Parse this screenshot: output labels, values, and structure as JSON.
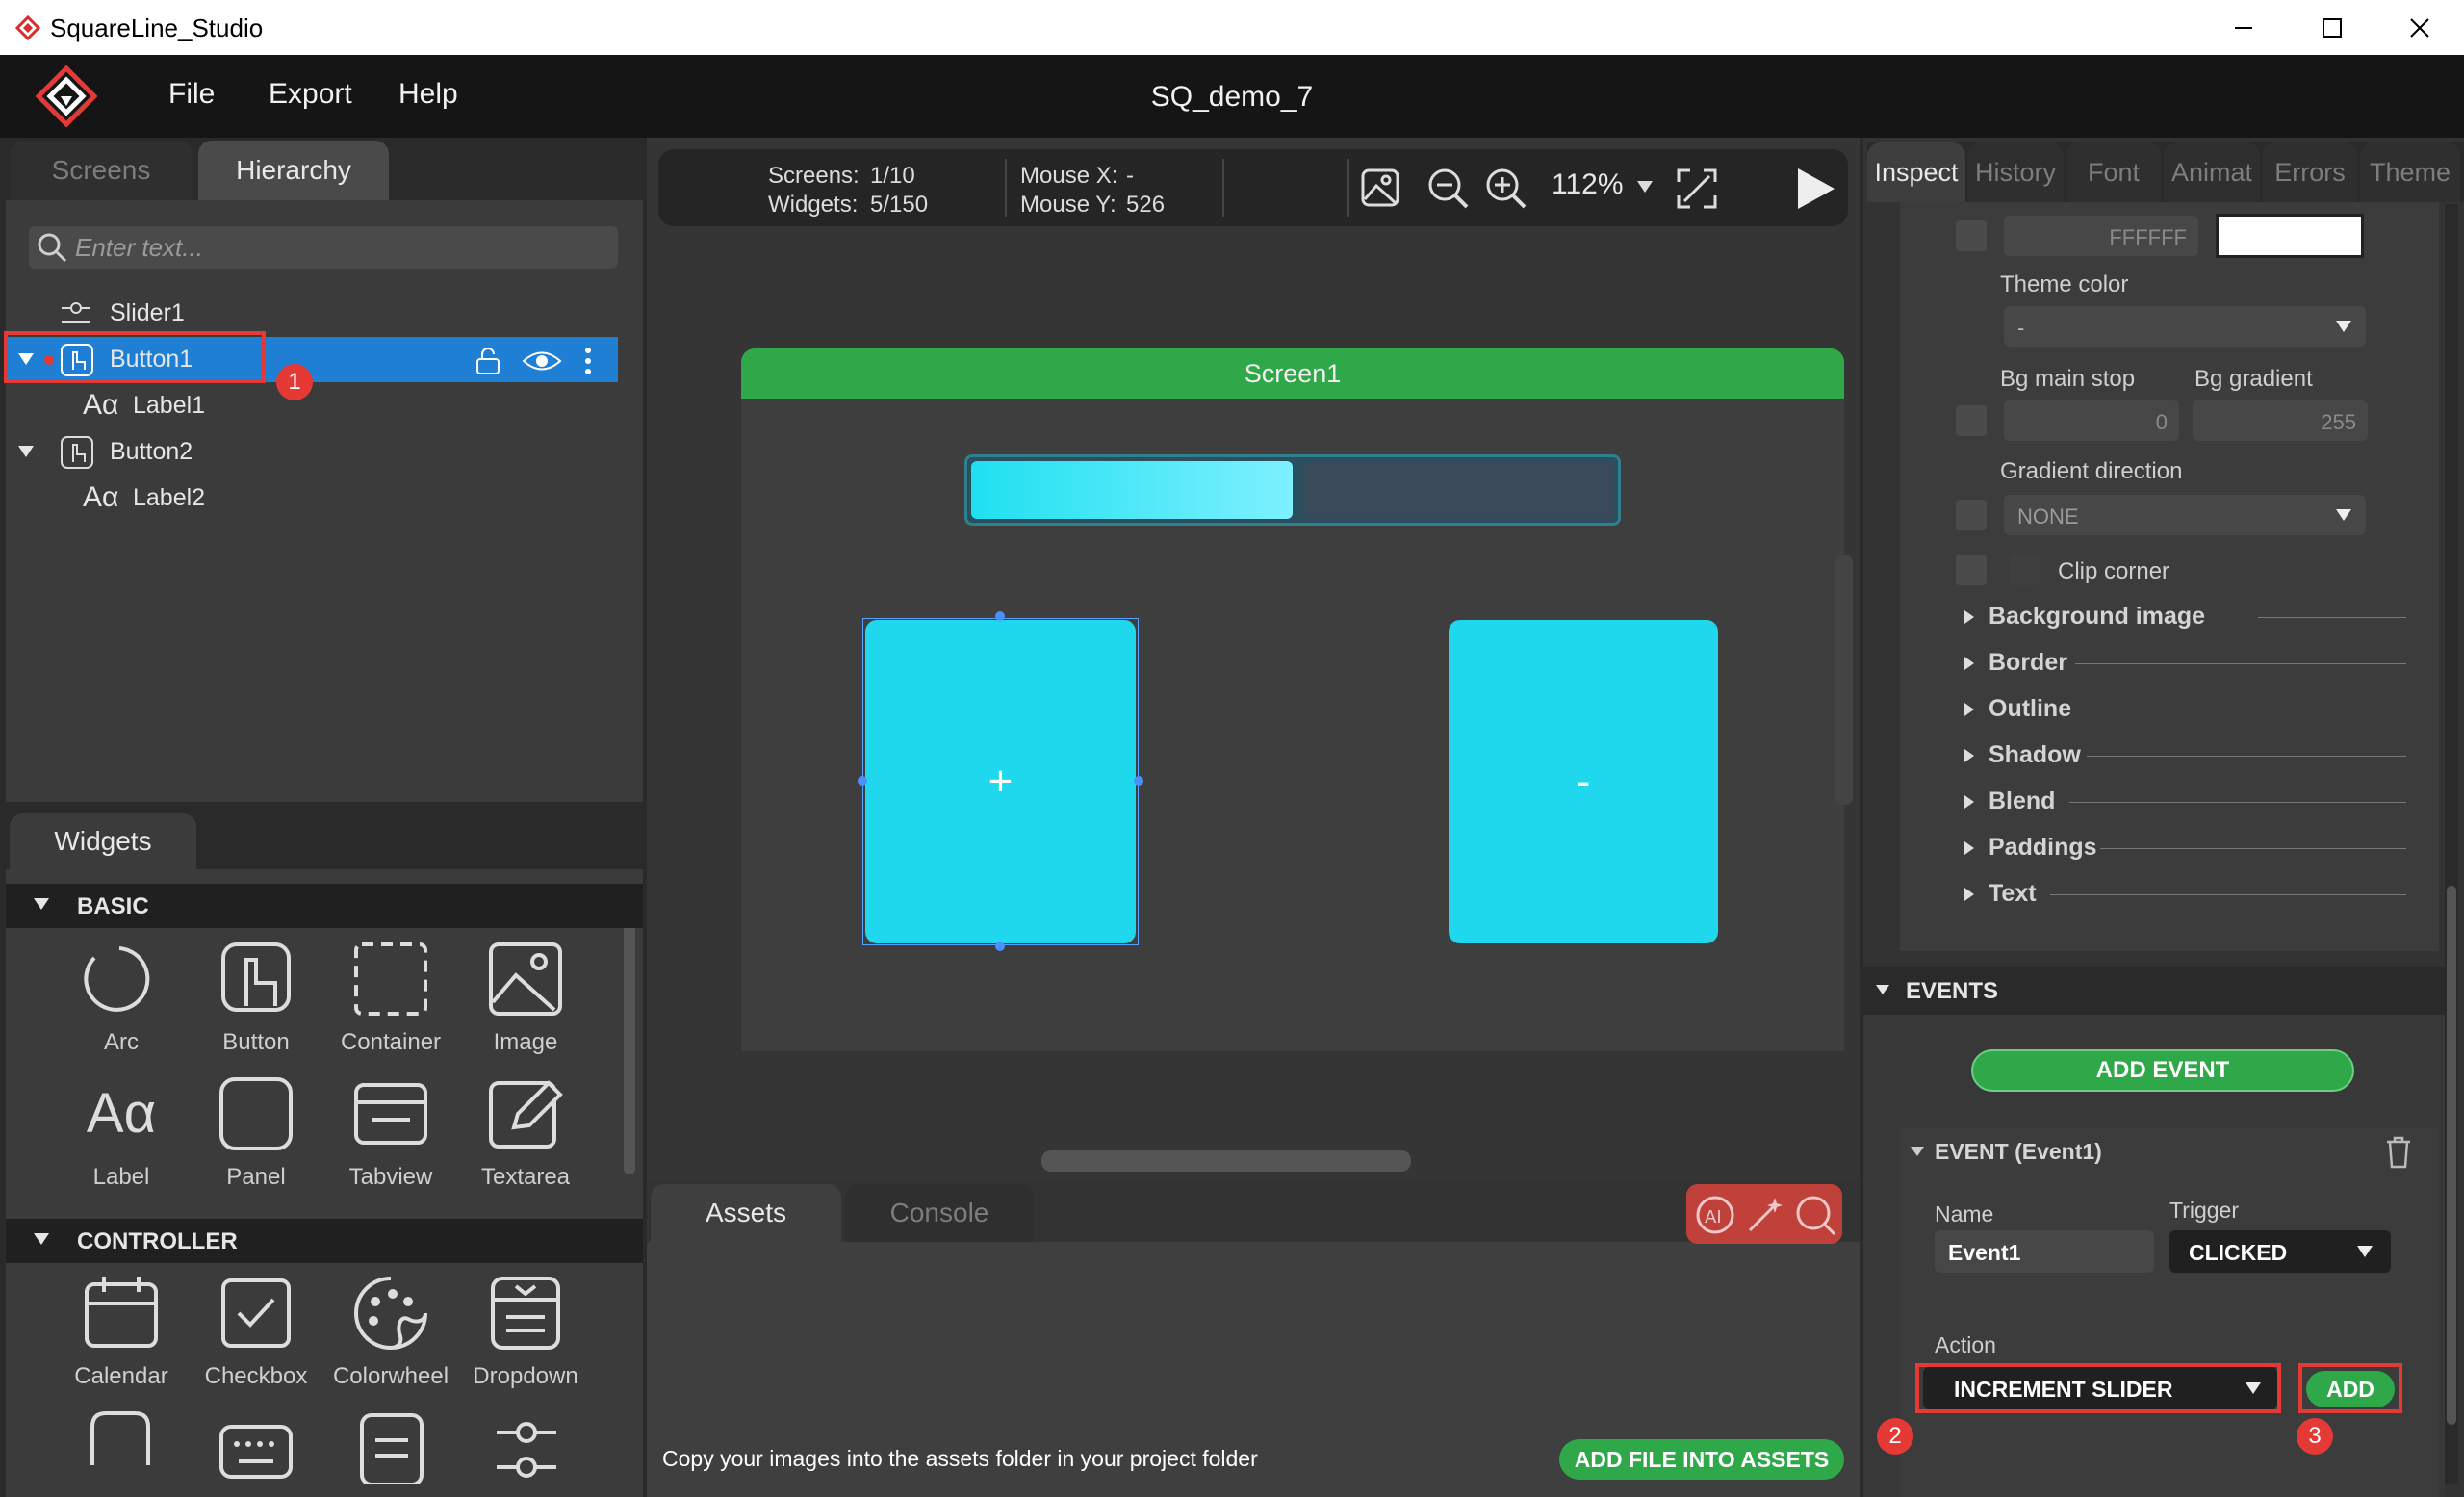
{
  "window": {
    "app_title": "SquareLine_Studio"
  },
  "menu": {
    "file": "File",
    "export": "Export",
    "help": "Help",
    "project_title": "SQ_demo_7"
  },
  "left_tabs": {
    "screens": "Screens",
    "hierarchy": "Hierarchy"
  },
  "search": {
    "placeholder": "Enter text..."
  },
  "hierarchy": {
    "items": [
      {
        "label": "Slider1"
      },
      {
        "label": "Button1"
      },
      {
        "label": "Label1"
      },
      {
        "label": "Button2"
      },
      {
        "label": "Label2"
      }
    ]
  },
  "widgets": {
    "tab": "Widgets",
    "basic_title": "BASIC",
    "controller_title": "CONTROLLER",
    "basic": [
      "Arc",
      "Button",
      "Container",
      "Image",
      "Label",
      "Panel",
      "Tabview",
      "Textarea"
    ],
    "controller": [
      "Calendar",
      "Checkbox",
      "Colorwheel",
      "Dropdown"
    ]
  },
  "toolbar": {
    "screens_label": "Screens:",
    "screens_value": "1/10",
    "widgets_label": "Widgets:",
    "widgets_value": "5/150",
    "mouse_x_label": "Mouse X:",
    "mouse_x_value": "-",
    "mouse_y_label": "Mouse Y:",
    "mouse_y_value": "526",
    "zoom": "112%"
  },
  "canvas": {
    "screen_name": "Screen1",
    "slider_value_fraction": 0.5,
    "button_plus": "+",
    "button_minus": "-"
  },
  "bottom": {
    "assets_tab": "Assets",
    "console_tab": "Console",
    "hint": "Copy your images into the assets folder in your project folder",
    "add_file_button": "ADD FILE INTO ASSETS"
  },
  "inspect": {
    "tabs": [
      "Inspect",
      "History",
      "Font",
      "Animat",
      "Errors",
      "Theme"
    ],
    "color_hex": "FFFFFF",
    "theme_color_label": "Theme color",
    "theme_color_value": "-",
    "bg_main_stop_label": "Bg main stop",
    "bg_main_stop_value": "0",
    "bg_gradient_label": "Bg gradient",
    "bg_gradient_value": "255",
    "gradient_direction_label": "Gradient direction",
    "gradient_direction_value": "NONE",
    "clip_corner_label": "Clip corner",
    "sections": [
      "Background image",
      "Border",
      "Outline",
      "Shadow",
      "Blend",
      "Paddings",
      "Text"
    ],
    "events_title": "EVENTS",
    "add_event_button": "ADD EVENT",
    "event_title": "EVENT (Event1)",
    "name_label": "Name",
    "name_value": "Event1",
    "trigger_label": "Trigger",
    "trigger_value": "CLICKED",
    "action_label": "Action",
    "action_value": "INCREMENT SLIDER",
    "add_button": "ADD"
  },
  "annotations": {
    "badge1": "1",
    "badge2": "2",
    "badge3": "3"
  },
  "colors": {
    "accent_green": "#2fa84a",
    "selection_blue": "#1f7fd4",
    "widget_cyan": "#1fd8ee",
    "highlight_red": "#e53935"
  }
}
